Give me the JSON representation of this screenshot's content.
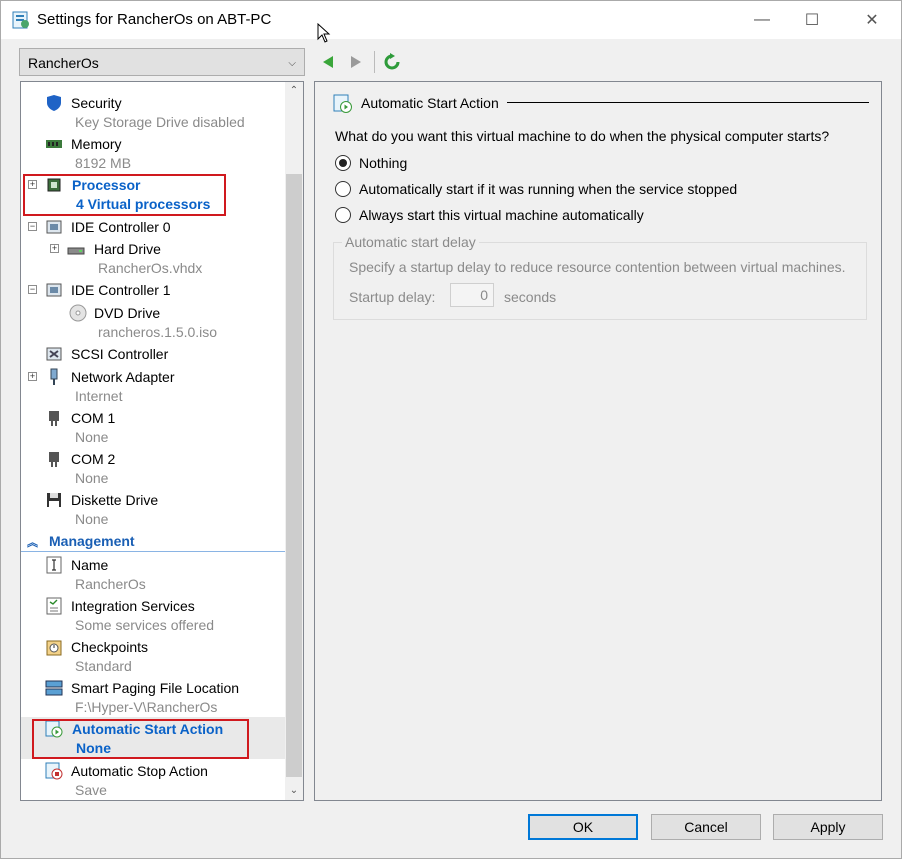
{
  "window": {
    "title": "Settings for RancherOs on ABT-PC",
    "minimize_glyph": "—",
    "maximize_glyph": "☐",
    "close_glyph": "✕"
  },
  "vm_selector": {
    "value": "RancherOs"
  },
  "tree": {
    "hardware_items": [
      {
        "label": "Security",
        "sub": "Key Storage Drive disabled",
        "icon": "shield-icon"
      },
      {
        "label": "Memory",
        "sub": "8192 MB",
        "icon": "memory-icon"
      },
      {
        "label": "Processor",
        "sub": "4 Virtual processors",
        "icon": "processor-icon",
        "highlighted": true
      },
      {
        "label": "IDE Controller 0",
        "sub": "",
        "icon": "ide-controller-icon"
      },
      {
        "label": "Hard Drive",
        "sub": "RancherOs.vhdx",
        "icon": "hard-drive-icon"
      },
      {
        "label": "IDE Controller 1",
        "sub": "",
        "icon": "ide-controller-icon"
      },
      {
        "label": "DVD Drive",
        "sub": "rancheros.1.5.0.iso",
        "icon": "dvd-drive-icon"
      },
      {
        "label": "SCSI Controller",
        "sub": "",
        "icon": "scsi-controller-icon"
      },
      {
        "label": "Network Adapter",
        "sub": "Internet",
        "icon": "network-adapter-icon"
      },
      {
        "label": "COM 1",
        "sub": "None",
        "icon": "com-port-icon"
      },
      {
        "label": "COM 2",
        "sub": "None",
        "icon": "com-port-icon"
      },
      {
        "label": "Diskette Drive",
        "sub": "None",
        "icon": "diskette-icon"
      }
    ],
    "management_header": "Management",
    "management_items": [
      {
        "label": "Name",
        "sub": "RancherOs",
        "icon": "name-icon"
      },
      {
        "label": "Integration Services",
        "sub": "Some services offered",
        "icon": "integration-services-icon"
      },
      {
        "label": "Checkpoints",
        "sub": "Standard",
        "icon": "checkpoints-icon"
      },
      {
        "label": "Smart Paging File Location",
        "sub": "F:\\Hyper-V\\RancherOs",
        "icon": "smart-paging-icon"
      },
      {
        "label": "Automatic Start Action",
        "sub": "None",
        "icon": "auto-start-icon",
        "highlighted": true
      },
      {
        "label": "Automatic Stop Action",
        "sub": "Save",
        "icon": "auto-stop-icon"
      }
    ]
  },
  "panel": {
    "section_title": "Automatic Start Action",
    "question": "What do you want this virtual machine to do when the physical computer starts?",
    "options": [
      {
        "label": "Nothing",
        "selected": true
      },
      {
        "label": "Automatically start if it was running when the service stopped",
        "selected": false
      },
      {
        "label": "Always start this virtual machine automatically",
        "selected": false
      }
    ],
    "delay_group": {
      "title": "Automatic start delay",
      "description": "Specify a startup delay to reduce resource contention between virtual machines.",
      "delay_label": "Startup delay:",
      "delay_value": "0",
      "delay_unit": "seconds"
    }
  },
  "buttons": {
    "ok": "OK",
    "cancel": "Cancel",
    "apply": "Apply"
  },
  "colors": {
    "highlight_text": "#0a62c8",
    "red_box": "#d0191e",
    "ok_border": "#0078d7"
  }
}
